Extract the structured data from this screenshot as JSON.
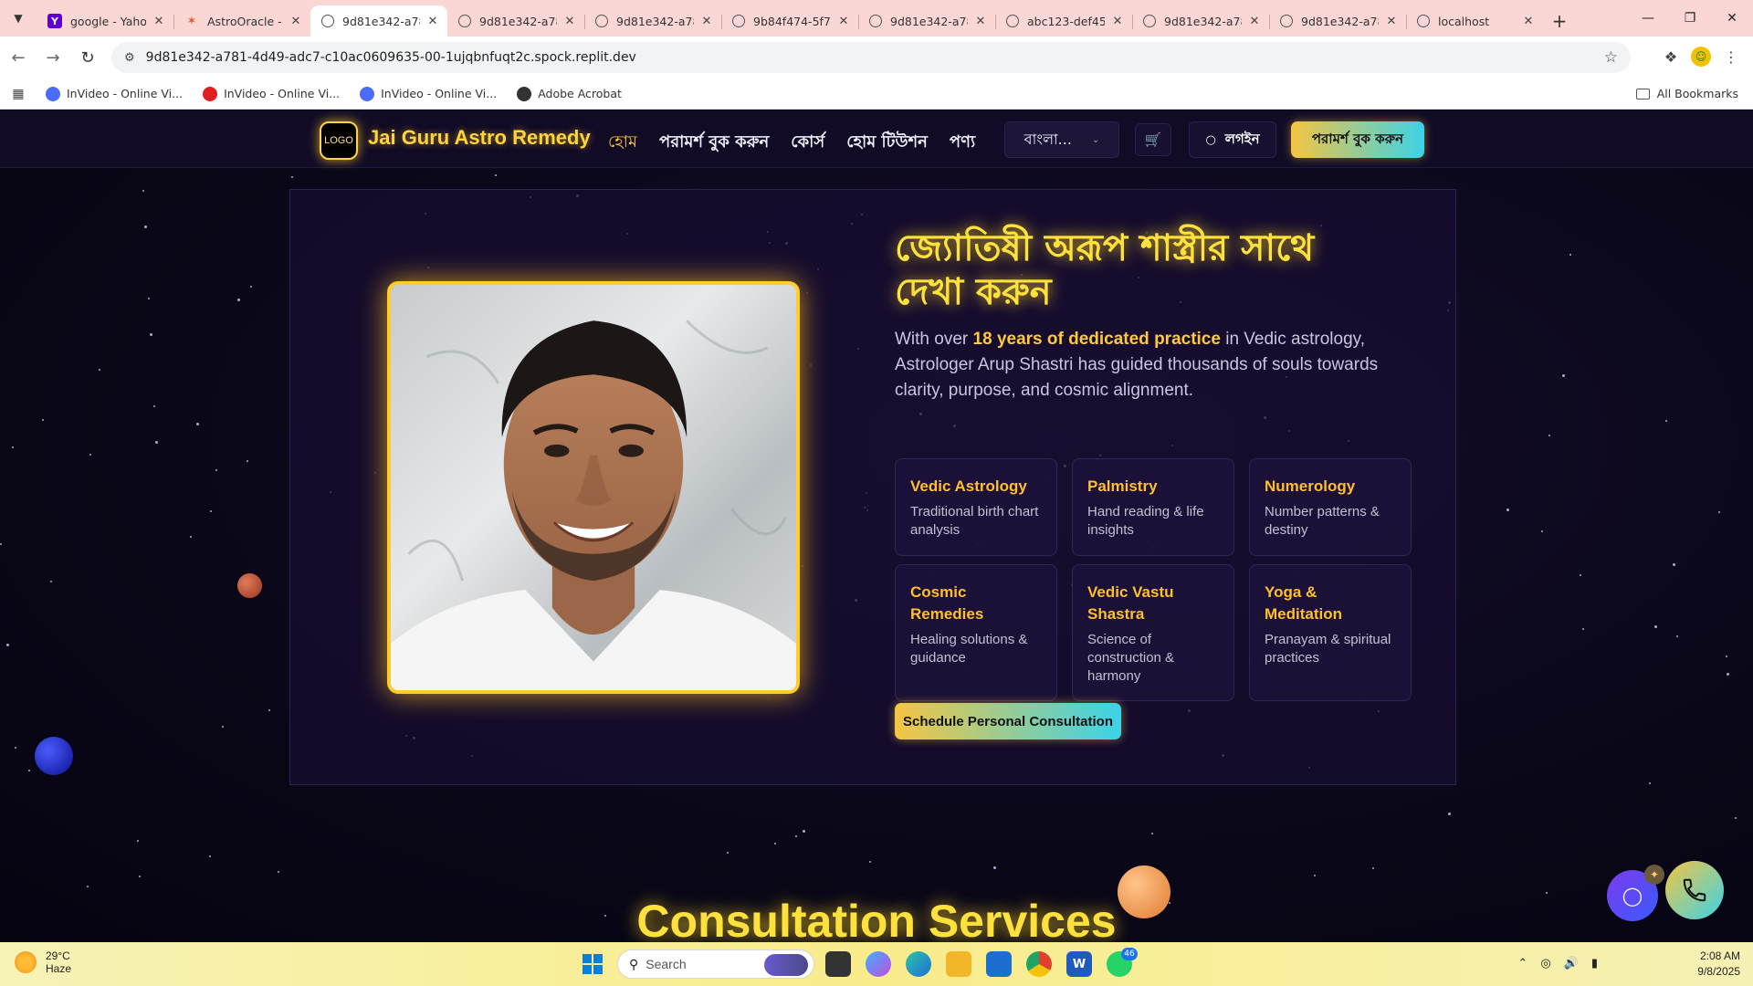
{
  "browser": {
    "tabs": [
      {
        "title": "google - Yahoo",
        "favicon": "yahoo-icon",
        "active": false
      },
      {
        "title": "AstroOracle - P",
        "favicon": "astro-icon",
        "active": false
      },
      {
        "title": "9d81e342-a781",
        "favicon": "globe-icon",
        "active": true
      },
      {
        "title": "9d81e342-a781",
        "favicon": "globe-icon",
        "active": false
      },
      {
        "title": "9d81e342-a781",
        "favicon": "globe-icon",
        "active": false
      },
      {
        "title": "9b84f474-5f75",
        "favicon": "globe-icon",
        "active": false
      },
      {
        "title": "9d81e342-a781",
        "favicon": "globe-icon",
        "active": false
      },
      {
        "title": "abc123-def456",
        "favicon": "globe-icon",
        "active": false
      },
      {
        "title": "9d81e342-a781",
        "favicon": "globe-icon",
        "active": false
      },
      {
        "title": "9d81e342-a781",
        "favicon": "globe-icon",
        "active": false
      },
      {
        "title": "localhost",
        "favicon": "globe-icon",
        "active": false
      }
    ],
    "url": "9d81e342-a781-4d49-adc7-c10ac0609635-00-1ujqbnfuqt2c.spock.replit.dev",
    "bookmarks": [
      {
        "label": "InVideo - Online Vi...",
        "color": "#4a6cf7"
      },
      {
        "label": "InVideo - Online Vi...",
        "color": "#e02020"
      },
      {
        "label": "InVideo - Online Vi...",
        "color": "#4a6cf7"
      },
      {
        "label": "Adobe Acrobat",
        "color": "#333333"
      }
    ],
    "all_bookmarks": "All Bookmarks"
  },
  "site": {
    "logo_text": "LOGO",
    "brand": "Jai Guru Astro Remedy",
    "menu": [
      "হোম",
      "পরামর্শ বুক করুন",
      "কোর্স",
      "হোম টিউশন",
      "পণ্য"
    ],
    "language": "বাংলা...",
    "login": "লগইন",
    "cta_top": "পরামর্শ বুক করুন",
    "accent": "#ffc93a"
  },
  "hero": {
    "headline": "জ্যোতিষী অরূপ শাস্ত্রীর সাথে দেখা করুন",
    "intro_before": "With over ",
    "intro_highlight": "18 years of dedicated practice",
    "intro_after": " in Vedic astrology, Astrologer Arup Shastri has guided thousands of souls towards clarity, purpose, and cosmic alignment.",
    "services": [
      {
        "title": "Vedic Astrology",
        "desc": "Traditional birth chart analysis"
      },
      {
        "title": "Palmistry",
        "desc": "Hand reading & life insights"
      },
      {
        "title": "Numerology",
        "desc": "Number patterns & destiny"
      },
      {
        "title": "Cosmic Remedies",
        "desc": "Healing solutions & guidance"
      },
      {
        "title": "Vedic Vastu Shastra",
        "desc": "Science of construction & harmony"
      },
      {
        "title": "Yoga & Meditation",
        "desc": "Pranayam & spiritual practices"
      }
    ],
    "cta": "Schedule Personal Consultation"
  },
  "next_section_title": "Consultation Services",
  "taskbar": {
    "temp": "29°C",
    "condition": "Haze",
    "search_placeholder": "Search",
    "whatsapp_badge": "46",
    "time": "2:08 AM",
    "date": "9/8/2025"
  }
}
